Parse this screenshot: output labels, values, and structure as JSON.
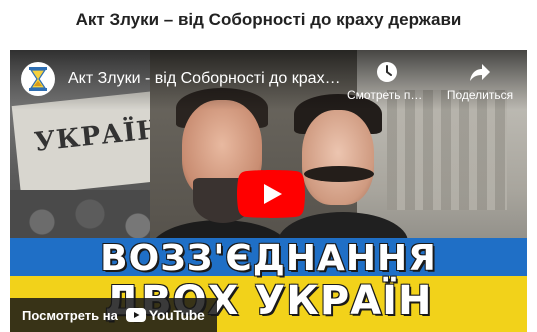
{
  "page": {
    "title": "Акт Злуки – від Соборності до краху держави"
  },
  "player": {
    "video_title": "Акт Злуки - від Соборності до краху держави",
    "channel_avatar_icon": "hourglass-icon",
    "watch_later_label": "Смотреть позже",
    "watch_later_icon": "clock-icon",
    "share_label": "Поделиться",
    "share_icon": "share-arrow-icon",
    "play_icon": "youtube-play-icon",
    "watch_on_label": "Посмотреть на",
    "youtube_word": "YouTube",
    "colors": {
      "play_red": "#ff0000",
      "flag_blue": "#1f6fc6",
      "flag_yellow": "#f2d21a"
    }
  },
  "thumbnail": {
    "headline_line1": "ВОЗЗ'ЄДНАННЯ",
    "headline_line2": "ДВОХ УКРАЇН",
    "banner_text": "УКРАЇНА"
  }
}
